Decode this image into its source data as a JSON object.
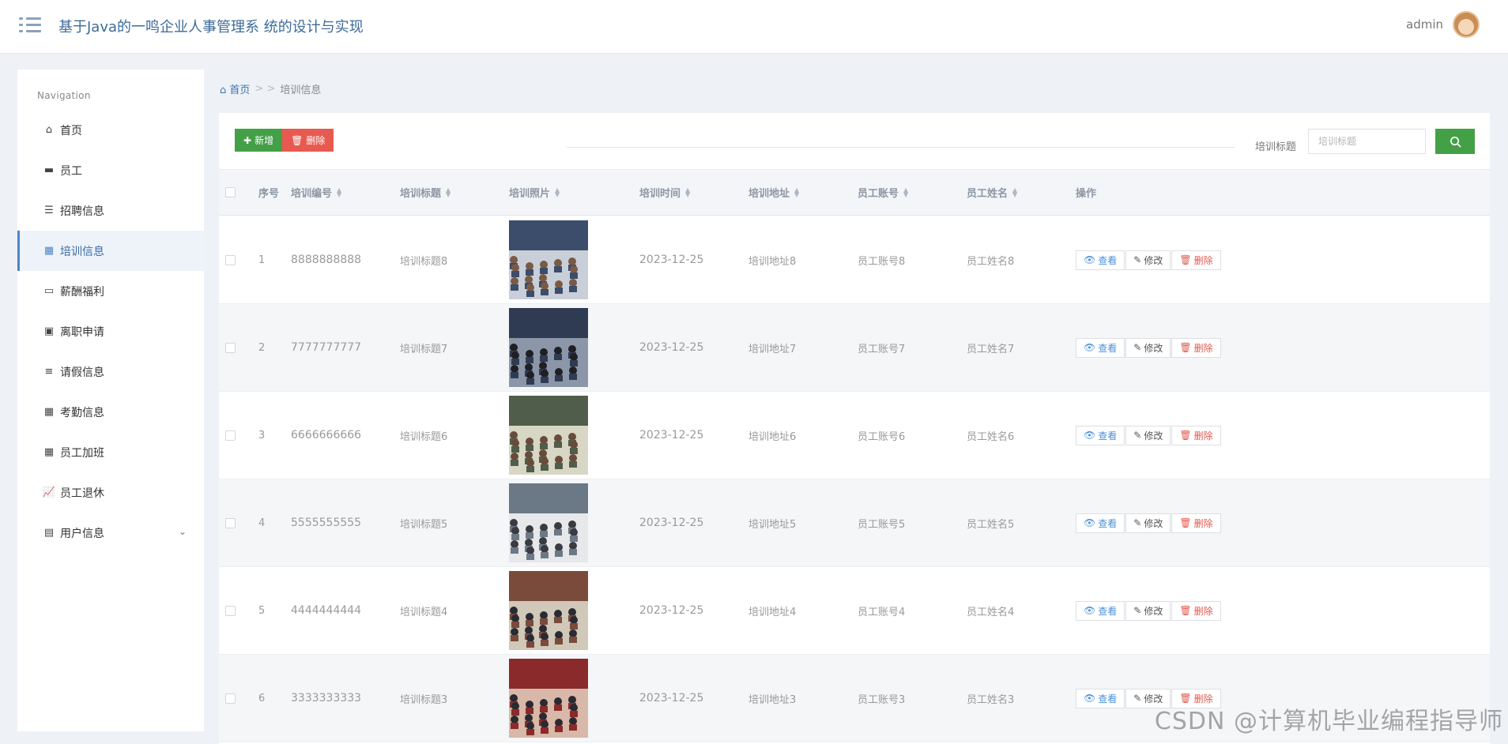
{
  "header": {
    "title": "基于Java的一鸣企业人事管理系 统的设计与实现",
    "user": "admin"
  },
  "sidebar": {
    "title": "Navigation",
    "items": [
      {
        "label": "首页",
        "icon": "home-icon"
      },
      {
        "label": "员工",
        "icon": "briefcase-icon"
      },
      {
        "label": "招聘信息",
        "icon": "list-icon"
      },
      {
        "label": "培训信息",
        "icon": "grid-icon",
        "active": true
      },
      {
        "label": "薪酬福利",
        "icon": "card-icon"
      },
      {
        "label": "离职申请",
        "icon": "clipboard-icon"
      },
      {
        "label": "请假信息",
        "icon": "sliders-icon"
      },
      {
        "label": "考勤信息",
        "icon": "grid-icon"
      },
      {
        "label": "员工加班",
        "icon": "grid-icon"
      },
      {
        "label": "员工退休",
        "icon": "chart-icon"
      },
      {
        "label": "用户信息",
        "icon": "id-card-icon",
        "expandable": true
      }
    ]
  },
  "breadcrumb": {
    "home": "首页",
    "separator": "> >",
    "current": "培训信息"
  },
  "toolbar": {
    "add_label": "新增",
    "delete_label": "删除"
  },
  "search": {
    "label": "培训标题",
    "placeholder": "培训标题"
  },
  "table": {
    "columns": [
      "序号",
      "培训编号",
      "培训标题",
      "培训照片",
      "培训时间",
      "培训地址",
      "员工账号",
      "员工姓名",
      "操作"
    ],
    "rows": [
      {
        "no": "1",
        "code": "8888888888",
        "title": "培训标题8",
        "time": "2023-12-25",
        "address": "培训地址8",
        "account": "员工账号8",
        "name": "员工姓名8",
        "photo": "meeting-photo"
      },
      {
        "no": "2",
        "code": "7777777777",
        "title": "培训标题7",
        "time": "2023-12-25",
        "address": "培训地址7",
        "account": "员工账号7",
        "name": "员工姓名7",
        "photo": "meeting-photo"
      },
      {
        "no": "3",
        "code": "6666666666",
        "title": "培训标题6",
        "time": "2023-12-25",
        "address": "培训地址6",
        "account": "员工账号6",
        "name": "员工姓名6",
        "photo": "classroom-photo"
      },
      {
        "no": "4",
        "code": "5555555555",
        "title": "培训标题5",
        "time": "2023-12-25",
        "address": "培训地址5",
        "account": "员工账号5",
        "name": "员工姓名5",
        "photo": "seminar-photo"
      },
      {
        "no": "5",
        "code": "4444444444",
        "title": "培训标题4",
        "time": "2023-12-25",
        "address": "培训地址4",
        "account": "员工账号4",
        "name": "员工姓名4",
        "photo": "lecture-hall-photo"
      },
      {
        "no": "6",
        "code": "3333333333",
        "title": "培训标题3",
        "time": "2023-12-25",
        "address": "培训地址3",
        "account": "员工账号3",
        "name": "员工姓名3",
        "photo": "conference-photo"
      }
    ],
    "actions": {
      "view": "查看",
      "edit": "修改",
      "delete": "删除"
    }
  },
  "watermark": "CSDN @计算机毕业编程指导师",
  "colors": {
    "primary_green": "#43a047",
    "danger_red": "#e85a4f",
    "link_blue": "#3a76b5",
    "active_bg": "#eef3fa"
  }
}
